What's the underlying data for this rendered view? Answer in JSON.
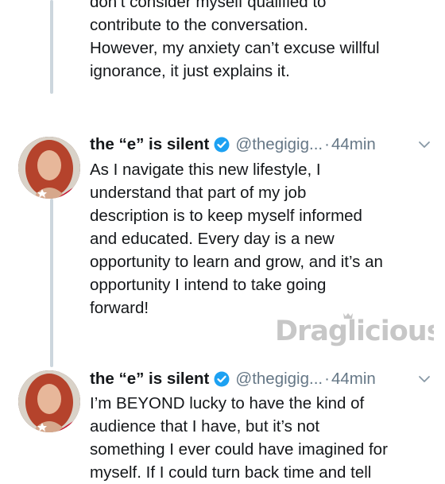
{
  "top_tweet": {
    "lines": [
      "don’t consider myself qualified to",
      "contribute to the conversation.",
      "However, my anxiety can’t excuse willful",
      "ignorance, it just explains it."
    ]
  },
  "tweets": [
    {
      "name": "the “e” is silent",
      "handle": "@thegigig...",
      "separator": "·",
      "time": "44min",
      "lines": [
        "As I navigate this new lifestyle, I",
        "understand that part of my job",
        "description is to keep myself informed",
        "and educated. Every day is a new",
        "opportunity to learn and grow, and it’s an",
        "opportunity I intend to take going",
        "forward!"
      ]
    },
    {
      "name": "the “e” is silent",
      "handle": "@thegigig...",
      "separator": "·",
      "time": "44min",
      "lines": [
        "I’m BEYOND lucky to have the kind of",
        "audience that I have, but it’s not",
        "something I ever could have imagined for",
        "myself. If I could turn back time and tell"
      ]
    }
  ],
  "watermark": {
    "text_part1": "Drag",
    "text_part2": "licious"
  },
  "icons": {
    "verified": "verified-badge-icon",
    "caret": "chevron-down-icon"
  },
  "colors": {
    "verified_blue": "#1da1f2",
    "muted_gray": "#657786",
    "thread_line": "#ccd6dd"
  }
}
